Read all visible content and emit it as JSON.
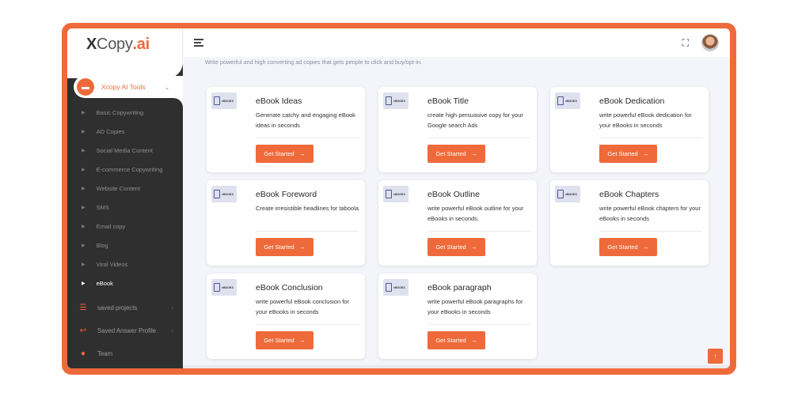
{
  "logo": {
    "x": "X",
    "copy": "Copy",
    "ai": ".ai"
  },
  "sidebar": {
    "tools_label": "Xcopy AI Tools",
    "items": [
      {
        "label": "Basic Copywriting"
      },
      {
        "label": "AD Copies"
      },
      {
        "label": "Social Media Content"
      },
      {
        "label": "E-commerce Copywriting"
      },
      {
        "label": "Website Content"
      },
      {
        "label": "SMS"
      },
      {
        "label": "Email copy"
      },
      {
        "label": "Blog"
      },
      {
        "label": "Viral Videos"
      },
      {
        "label": "eBook"
      }
    ],
    "bottom_items": [
      {
        "label": "saved projects"
      },
      {
        "label": "Saved Answer Profile"
      },
      {
        "label": "Team"
      }
    ]
  },
  "main": {
    "subtitle": "Write powerful and high converting ad copies that gets people to click and buy/opt-in.",
    "thumb_text": "eBOOKS",
    "button_label": "Get Started",
    "cards": [
      {
        "title": "eBook Ideas",
        "desc": "Generate catchy and engaging eBook ideas in seconds"
      },
      {
        "title": "eBook Title",
        "desc": "create high persuasive copy for your Google search Ads"
      },
      {
        "title": "eBook Dedication",
        "desc": "write powerful eBook dedication for your eBooks in seconds"
      },
      {
        "title": "eBook Foreword",
        "desc": "Create irresistible headlines for taboola"
      },
      {
        "title": "eBook Outline",
        "desc": "write powerful eBook outline for your eBooks in seconds."
      },
      {
        "title": "eBook Chapters",
        "desc": "write powerful eBook chapters for your eBooks in seconds"
      },
      {
        "title": "eBook Conclusion",
        "desc": "write powerful eBook conclusion for your eBooks in seconds"
      },
      {
        "title": "eBook paragraph",
        "desc": "write powerful eBook paragraphs for your eBooks in seconds"
      }
    ]
  },
  "colors": {
    "accent": "#ef6a3a",
    "sidebar": "#2f2f2f"
  }
}
